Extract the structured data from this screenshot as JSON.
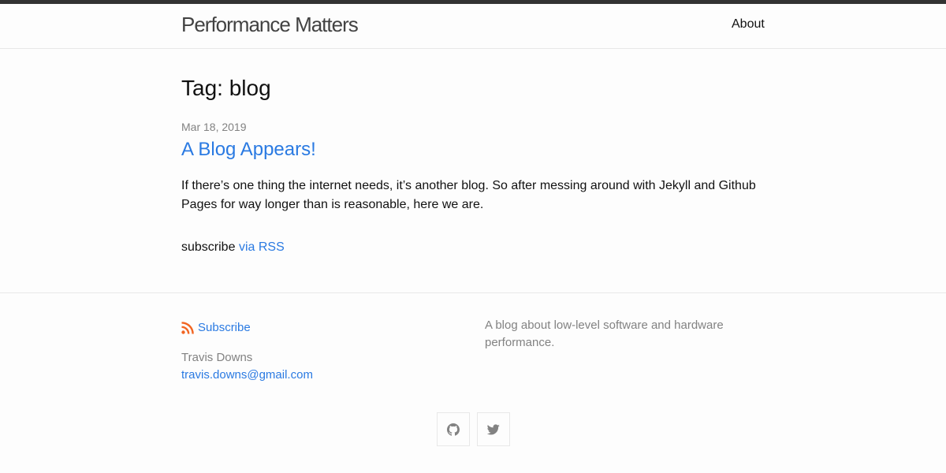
{
  "header": {
    "site_title": "Performance Matters",
    "nav": [
      {
        "label": "About"
      }
    ]
  },
  "main": {
    "page_heading": "Tag: blog",
    "posts": [
      {
        "date": "Mar 18, 2019",
        "title": "A Blog Appears!",
        "excerpt": "If there’s one thing the internet needs, it’s another blog. So after messing around with Jekyll and Github Pages for way longer than is reasonable, here we are."
      }
    ],
    "rss": {
      "prefix": "subscribe",
      "link_label": "via RSS"
    }
  },
  "footer": {
    "subscribe_label": "Subscribe",
    "author_name": "Travis Downs",
    "author_email": "travis.downs@gmail.com",
    "description": "A blog about low-level software and hardware performance.",
    "social": [
      {
        "icon": "github-icon"
      },
      {
        "icon": "twitter-icon"
      }
    ]
  },
  "colors": {
    "link": "#2a7ae2",
    "muted": "#828282",
    "rss_orange": "#f26522",
    "topbar": "#333333"
  }
}
